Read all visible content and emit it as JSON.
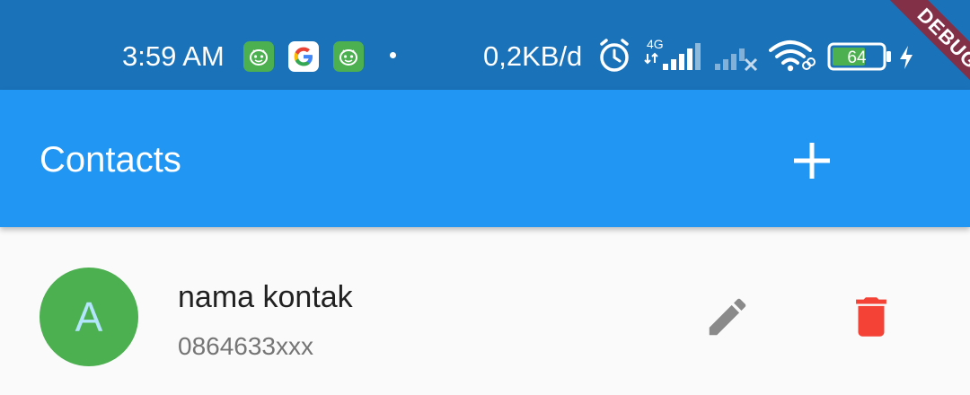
{
  "status_bar": {
    "time": "3:59 AM",
    "net_speed": "0,2KB/d",
    "network_type": "4G",
    "battery_level": "64",
    "icons": [
      "robot-app-icon",
      "google-icon",
      "robot-app-icon",
      "dot-icon",
      "alarm-icon",
      "signal-4g-icon",
      "signal-no-sim-icon",
      "wifi-icon",
      "battery-icon",
      "charging-icon"
    ]
  },
  "debug_banner": {
    "label": "DEBUG"
  },
  "app_bar": {
    "title": "Contacts",
    "actions": [
      "add-icon"
    ]
  },
  "contacts": [
    {
      "avatar_letter": "A",
      "name": "nama kontak",
      "phone": "0864633xxx"
    }
  ],
  "colors": {
    "status_bar": "#1a72b9",
    "app_bar": "#2196f3",
    "avatar": "#4caf50",
    "avatar_letter": "#b3e5fc",
    "edit_icon": "#8a8a8a",
    "delete_icon": "#f44336",
    "background": "#fafafa"
  }
}
